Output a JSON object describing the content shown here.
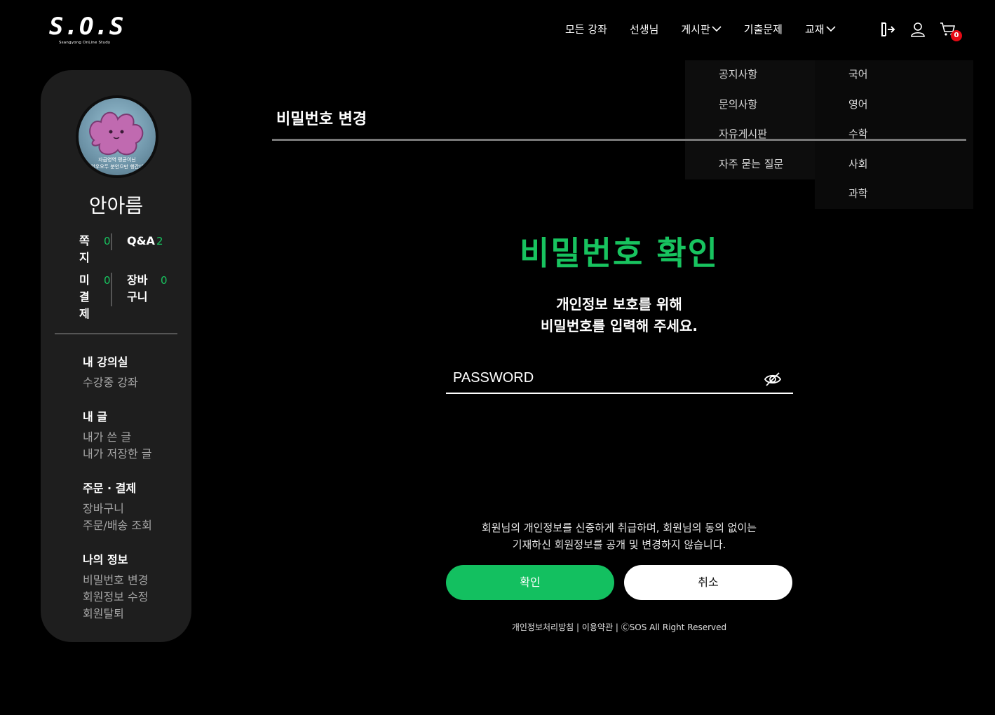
{
  "logo": {
    "main": "S.O.S",
    "sub": "Ssangyong OnLine Study"
  },
  "nav": {
    "items": [
      "모든 강좌",
      "선생님",
      "게시판",
      "기출문제",
      "교재"
    ],
    "cart_count": "0",
    "icons": [
      "logout-icon",
      "user-icon",
      "cart-icon"
    ]
  },
  "dropdowns": {
    "board": [
      "공지사항",
      "문의사항",
      "자유게시판",
      "자주 묻는 질문"
    ],
    "book": [
      "국어",
      "영어",
      "수학",
      "사회",
      "과학"
    ]
  },
  "sidebar": {
    "avatar_caption_1": "자급영역 평균이닌",
    "avatar_caption_2": "어우오두 분안으만 행간다",
    "name": "안아름",
    "stats": {
      "note_label": "쪽\n지",
      "note_value": "0",
      "qa_label": "Q&A",
      "qa_value": "2",
      "unpaid_label": "미\n결\n제",
      "unpaid_value": "0",
      "cart_label": "장바\n구니",
      "cart_value": "0"
    },
    "menu": {
      "lecture_head": "내 강의실",
      "lecture_links": [
        "수강중 강좌"
      ],
      "post_head": "내 글",
      "post_links": [
        "내가 쓴 글",
        "내가 저장한 글"
      ],
      "order_head": "주문 · 결제",
      "order_links": [
        "장바구니",
        "주문/배송 조회"
      ],
      "info_head": "나의 정보",
      "info_links": [
        "비밀번호 변경",
        "회원정보 수정",
        "회원탈퇴"
      ]
    }
  },
  "main": {
    "page_title": "비밀번호 변경",
    "confirm_title": "비밀번호 확인",
    "guide_line1": "개인정보 보호를 위해",
    "guide_line2": "비밀번호를 입력해 주세요.",
    "password_placeholder": "PASSWORD",
    "notice_line1": "회원님의 개인정보를 신중하게 취급하며, 회원님의 동의 없이는",
    "notice_line2": "기재하신 회원정보를 공개 및 변경하지 않습니다.",
    "ok_button": "확인",
    "cancel_button": "취소",
    "footer_privacy": "개인정보처리방침",
    "footer_sep1": " | ",
    "footer_terms": "이용약관",
    "footer_sep2": " | ",
    "footer_copy": "ⒸSOS All Right Reserved"
  },
  "colors": {
    "accent": "#18c35f",
    "badge": "#e50914",
    "sidebar_bg": "#1e1e1e"
  }
}
